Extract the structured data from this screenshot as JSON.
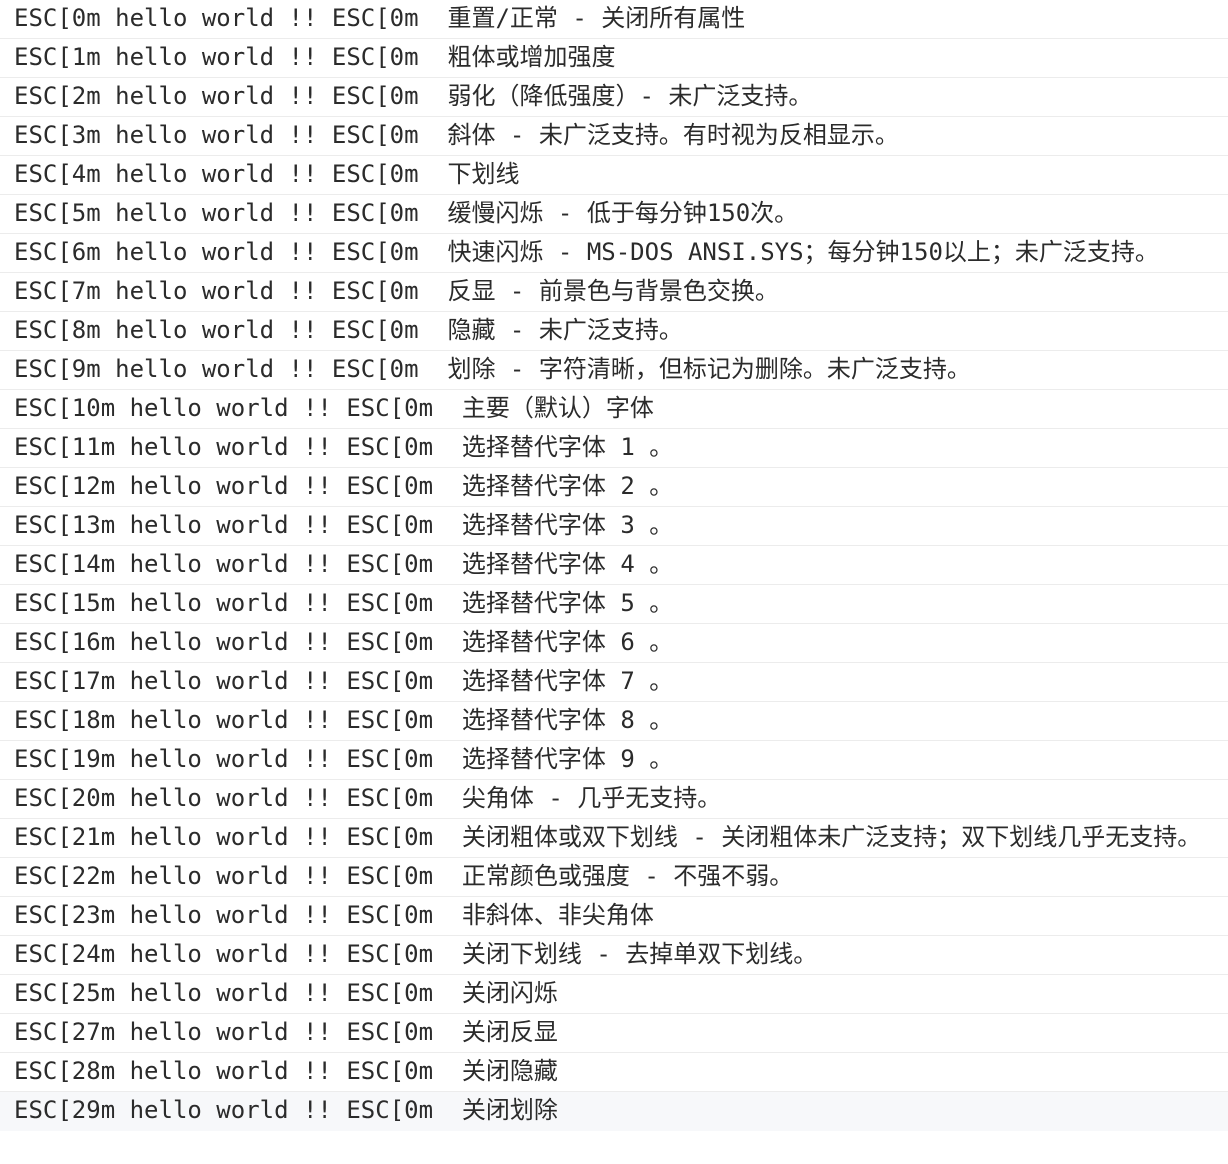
{
  "console": {
    "lines": [
      "ESC[0m hello world !! ESC[0m  重置/正常 - 关闭所有属性",
      "ESC[1m hello world !! ESC[0m  粗体或增加强度",
      "ESC[2m hello world !! ESC[0m  弱化（降低强度）- 未广泛支持。",
      "ESC[3m hello world !! ESC[0m  斜体 - 未广泛支持。有时视为反相显示。",
      "ESC[4m hello world !! ESC[0m  下划线",
      "ESC[5m hello world !! ESC[0m  缓慢闪烁 - 低于每分钟150次。",
      "ESC[6m hello world !! ESC[0m  快速闪烁 - MS-DOS ANSI.SYS；每分钟150以上；未广泛支持。",
      "ESC[7m hello world !! ESC[0m  反显 - 前景色与背景色交换。",
      "ESC[8m hello world !! ESC[0m  隐藏 - 未广泛支持。",
      "ESC[9m hello world !! ESC[0m  划除 - 字符清晰，但标记为删除。未广泛支持。",
      "ESC[10m hello world !! ESC[0m  主要（默认）字体",
      "ESC[11m hello world !! ESC[0m  选择替代字体 1 。",
      "ESC[12m hello world !! ESC[0m  选择替代字体 2 。",
      "ESC[13m hello world !! ESC[0m  选择替代字体 3 。",
      "ESC[14m hello world !! ESC[0m  选择替代字体 4 。",
      "ESC[15m hello world !! ESC[0m  选择替代字体 5 。",
      "ESC[16m hello world !! ESC[0m  选择替代字体 6 。",
      "ESC[17m hello world !! ESC[0m  选择替代字体 7 。",
      "ESC[18m hello world !! ESC[0m  选择替代字体 8 。",
      "ESC[19m hello world !! ESC[0m  选择替代字体 9 。",
      "ESC[20m hello world !! ESC[0m  尖角体 - 几乎无支持。",
      "ESC[21m hello world !! ESC[0m  关闭粗体或双下划线 - 关闭粗体未广泛支持；双下划线几乎无支持。",
      "ESC[22m hello world !! ESC[0m  正常颜色或强度 - 不强不弱。",
      "ESC[23m hello world !! ESC[0m  非斜体、非尖角体",
      "ESC[24m hello world !! ESC[0m  关闭下划线 - 去掉单双下划线。",
      "ESC[25m hello world !! ESC[0m  关闭闪烁",
      "ESC[27m hello world !! ESC[0m  关闭反显",
      "ESC[28m hello world !! ESC[0m  关闭隐藏",
      "ESC[29m hello world !! ESC[0m  关闭划除"
    ]
  }
}
